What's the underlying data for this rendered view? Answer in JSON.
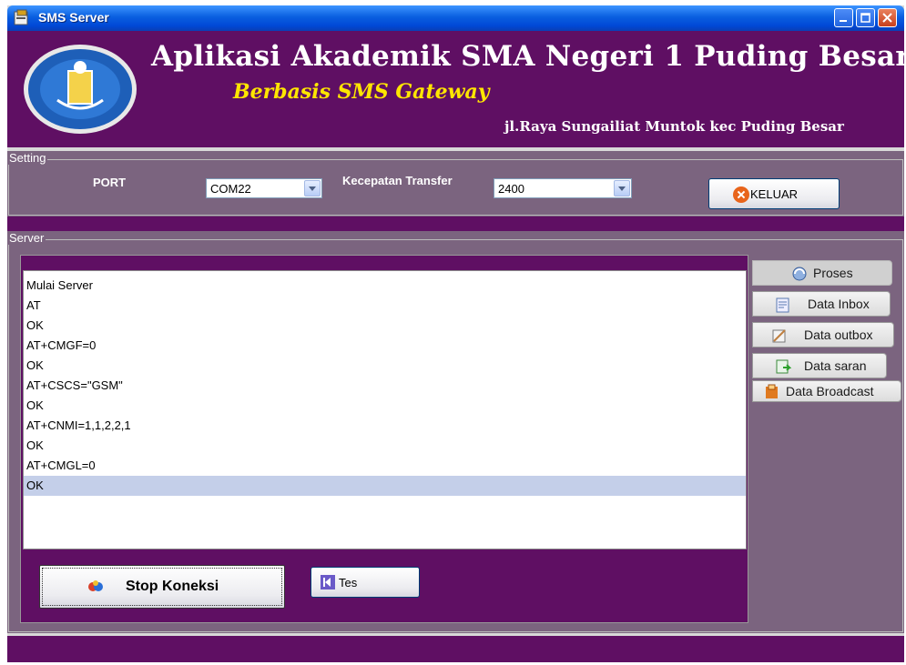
{
  "window": {
    "title": "SMS Server"
  },
  "header": {
    "app_title": "Aplikasi Akademik SMA Negeri 1 Puding Besar",
    "subtitle": "Berbasis SMS Gateway",
    "address": "jl.Raya Sungailiat Muntok kec Puding Besar"
  },
  "setting": {
    "legend": "Setting",
    "port_label": "PORT",
    "port_value": "COM22",
    "speed_label": "Kecepatan Transfer",
    "speed_value": "2400",
    "exit_label": "KELUAR"
  },
  "server": {
    "legend": "Server",
    "log": [
      "Mulai Server",
      "AT",
      "OK",
      "AT+CMGF=0",
      "OK",
      "AT+CSCS=\"GSM\"",
      "OK",
      "AT+CNMI=1,1,2,2,1",
      "OK",
      "AT+CMGL=0",
      "OK"
    ],
    "selected_index": 10,
    "stop_label": "Stop Koneksi",
    "test_label": "Tes"
  },
  "tabs": [
    "Proses",
    "Data Inbox",
    "Data outbox",
    "Data saran",
    "Data Broadcast"
  ],
  "colors": {
    "theme_purple": "#5f0f63",
    "panel_mauve": "#7b647f",
    "title_yellow": "#ffe600"
  }
}
